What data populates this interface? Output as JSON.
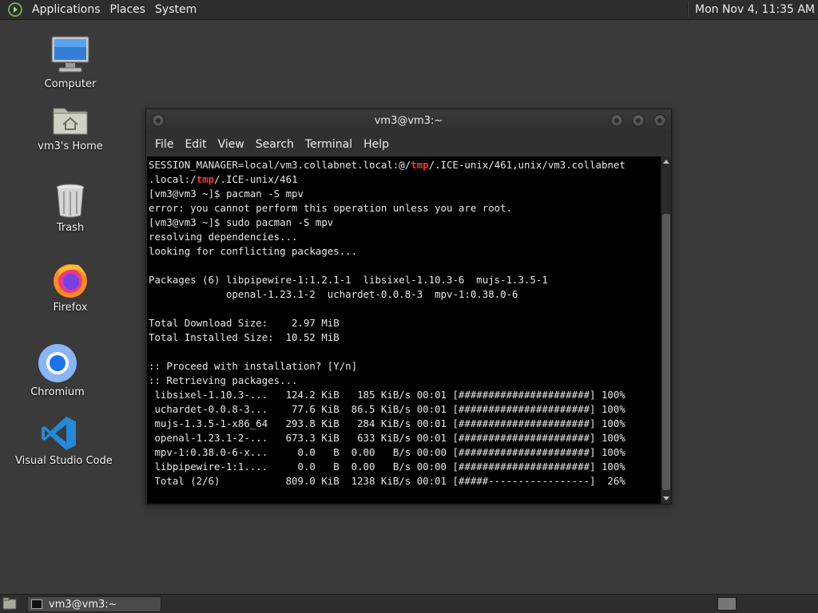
{
  "top_panel": {
    "menus": [
      "Applications",
      "Places",
      "System"
    ],
    "clock": "Mon Nov  4, 11:35 AM"
  },
  "desktop_icons": [
    {
      "label": "Computer",
      "icon": "computer-icon"
    },
    {
      "label": "vm3's Home",
      "icon": "home-folder-icon"
    },
    {
      "label": "Trash",
      "icon": "trash-icon"
    },
    {
      "label": "Firefox",
      "icon": "firefox-icon"
    },
    {
      "label": "Chromium",
      "icon": "chromium-icon"
    },
    {
      "label": "Visual Studio Code",
      "icon": "vscode-icon"
    }
  ],
  "terminal": {
    "title": "vm3@vm3:~",
    "menus": [
      "File",
      "Edit",
      "View",
      "Search",
      "Terminal",
      "Help"
    ],
    "lines": [
      "SESSION_MANAGER=local/vm3.collabnet.local:@/tmp/.ICE-unix/461,unix/vm3.collabnet",
      ".local:/tmp/.ICE-unix/461",
      "[vm3@vm3 ~]$ pacman -S mpv",
      "error: you cannot perform this operation unless you are root.",
      "[vm3@vm3 ~]$ sudo pacman -S mpv",
      "resolving dependencies...",
      "looking for conflicting packages...",
      "",
      "Packages (6) libpipewire-1:1.2.1-1  libsixel-1.10.3-6  mujs-1.3.5-1",
      "             openal-1.23.1-2  uchardet-0.0.8-3  mpv-1:0.38.0-6",
      "",
      "Total Download Size:    2.97 MiB",
      "Total Installed Size:  10.52 MiB",
      "",
      ":: Proceed with installation? [Y/n]",
      ":: Retrieving packages...",
      " libsixel-1.10.3-...   124.2 KiB   185 KiB/s 00:01 [######################] 100%",
      " uchardet-0.0.8-3...    77.6 KiB  86.5 KiB/s 00:01 [######################] 100%",
      " mujs-1.3.5-1-x86_64   293.8 KiB   284 KiB/s 00:01 [######################] 100%",
      " openal-1.23.1-2-...   673.3 KiB   633 KiB/s 00:01 [######################] 100%",
      " mpv-1:0.38.0-6-x...     0.0   B  0.00   B/s 00:00 [######################] 100%",
      " libpipewire-1:1....     0.0   B  0.00   B/s 00:00 [######################] 100%",
      " Total (2/6)           809.0 KiB  1238 KiB/s 00:01 [#####-----------------]  26%"
    ],
    "highlight_word": "tmp",
    "highlight_color": "#ef3b3b"
  },
  "taskbar": {
    "window_button": "vm3@vm3:~"
  }
}
